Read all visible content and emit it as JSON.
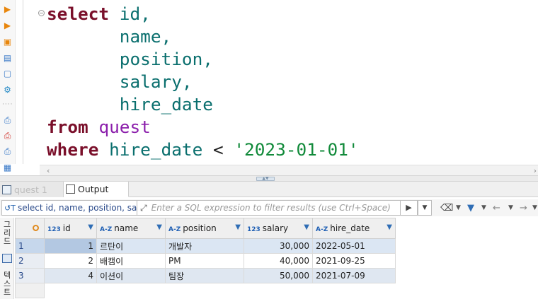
{
  "editor": {
    "lines": [
      [
        "select",
        " ",
        "id,"
      ],
      [
        "",
        "       ",
        "name,"
      ],
      [
        "",
        "       ",
        "position,"
      ],
      [
        "",
        "       ",
        "salary,"
      ],
      [
        "",
        "       ",
        "hire_date"
      ]
    ],
    "from_kw": "from",
    "from_table": "quest",
    "where_kw": "where",
    "where_col": "hire_date",
    "where_op": "<",
    "where_val": "'2023-01-01'"
  },
  "tabs": {
    "results_label": "quest 1",
    "output_label": "Output"
  },
  "filter": {
    "query_text": "select id, name, position, salary",
    "placeholder": "Enter a SQL expression to filter results (use Ctrl+Space)"
  },
  "side_tabs": {
    "grid": "그리드",
    "text": "텍스트"
  },
  "grid": {
    "columns": [
      {
        "type": "123",
        "name": "id"
      },
      {
        "type": "A-Z",
        "name": "name"
      },
      {
        "type": "A-Z",
        "name": "position"
      },
      {
        "type": "123",
        "name": "salary"
      },
      {
        "type": "A-Z",
        "name": "hire_date"
      }
    ],
    "rows": [
      {
        "num": "1",
        "id": "1",
        "name": "르탄이",
        "position": "개발자",
        "salary": "30,000",
        "hire_date": "2022-05-01"
      },
      {
        "num": "2",
        "id": "2",
        "name": "배캠이",
        "position": "PM",
        "salary": "40,000",
        "hire_date": "2021-09-25"
      },
      {
        "num": "3",
        "id": "4",
        "name": "이션이",
        "position": "팀장",
        "salary": "50,000",
        "hire_date": "2021-07-09"
      }
    ]
  },
  "colors": {
    "keyword": "#7a0f2a",
    "table": "#8b1eab",
    "string": "#118a3a",
    "identifier": "#0a6f6e",
    "selected_row": "#dbe6f3"
  }
}
